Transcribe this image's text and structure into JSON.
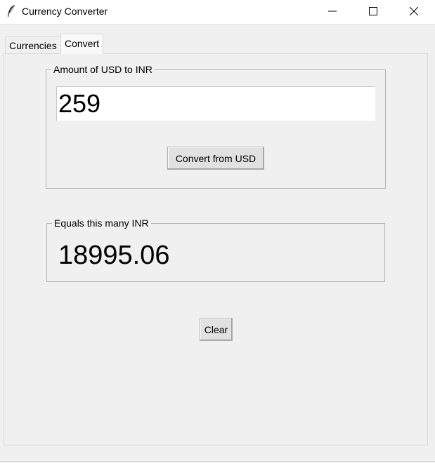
{
  "window": {
    "title": "Currency Converter",
    "icon": "feather-icon",
    "controls": [
      "minimize-icon",
      "maximize-icon",
      "close-icon"
    ]
  },
  "tabs": [
    {
      "label": "Currencies",
      "selected": false
    },
    {
      "label": "Convert",
      "selected": true
    }
  ],
  "amount_frame": {
    "legend": "Amount of USD to INR",
    "input_value": "259",
    "convert_button": "Convert from USD"
  },
  "result_frame": {
    "legend": "Equals this many INR",
    "value": "18995.06"
  },
  "clear_button": "Clear"
}
